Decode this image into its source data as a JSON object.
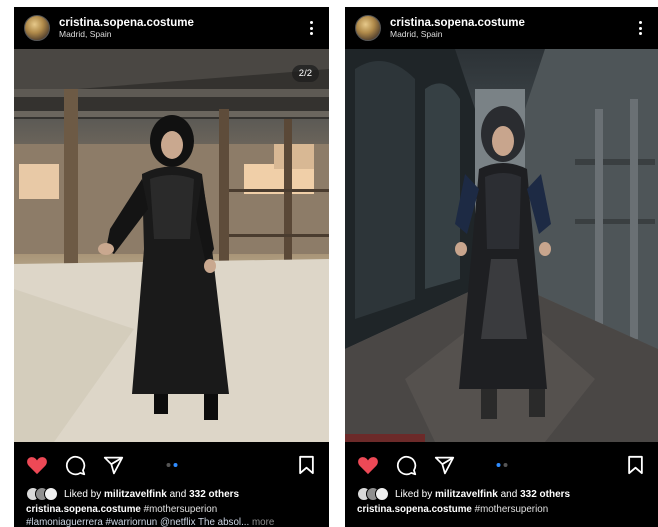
{
  "posts": [
    {
      "username": "cristina.sopena.costume",
      "location": "Madrid, Spain",
      "page_counter": "2/2",
      "liked_by_prefix": "Liked by",
      "liked_by_user": "militzavelfink",
      "liked_by_connector": "and",
      "liked_by_others": "332 others",
      "caption_user": "cristina.sopena.costume",
      "caption_tag": "#mothersuperion",
      "caption_line2": "#lamoniaguerrera #warriornun @netflix The absol...",
      "more_label": "more"
    },
    {
      "username": "cristina.sopena.costume",
      "location": "Madrid, Spain",
      "liked_by_prefix": "Liked by",
      "liked_by_user": "militzavelfink",
      "liked_by_connector": "and",
      "liked_by_others": "332 others",
      "caption_user": "cristina.sopena.costume",
      "caption_tag": "#mothersuperion"
    }
  ],
  "icons": {
    "like": "heart-icon",
    "comment": "comment-icon",
    "share": "send-icon",
    "save": "bookmark-icon",
    "menu": "more-vertical-icon"
  },
  "colors": {
    "like_red": "#ed4956",
    "active_dot": "#2f8cff"
  }
}
